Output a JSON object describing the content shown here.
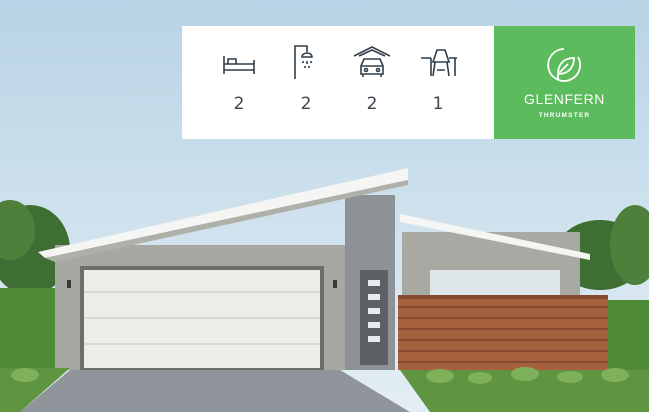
{
  "features": {
    "bedrooms": {
      "icon": "bed-icon",
      "value": "2"
    },
    "bathrooms": {
      "icon": "shower-icon",
      "value": "2"
    },
    "garage": {
      "icon": "garage-car-icon",
      "value": "2"
    },
    "living": {
      "icon": "dining-table-chair-icon",
      "value": "1"
    }
  },
  "brand": {
    "name": "GLENFERN",
    "model": "THRUMSTER",
    "icon": "leaf-icon",
    "color": "#5cbb5c"
  },
  "colors": {
    "sky": "#c9dfeb",
    "wall": "#a7a7a3",
    "cladding": "#8d9296",
    "roof": "#f5f5f3",
    "garage_door": "#eeece6",
    "fence": "#a5603e",
    "driveway": "#8f959a",
    "hedge": "#4f8a35"
  }
}
